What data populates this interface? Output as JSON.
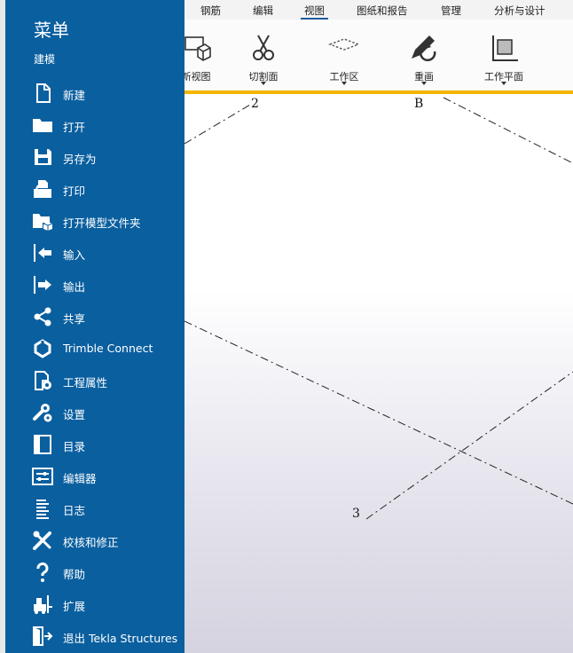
{
  "tabs": [
    {
      "label": "钢筋"
    },
    {
      "label": "编辑"
    },
    {
      "label": "视图"
    },
    {
      "label": "图纸和报告"
    },
    {
      "label": "管理"
    },
    {
      "label": "分析与设计"
    }
  ],
  "ribbon": {
    "items": [
      {
        "label": "新视图",
        "icon": "new-view-icon"
      },
      {
        "label": "切割面",
        "icon": "scissors-icon"
      },
      {
        "label": "工作区",
        "icon": "work-area-icon"
      },
      {
        "label": "重画",
        "icon": "redraw-icon"
      },
      {
        "label": "工作平面",
        "icon": "work-plane-icon"
      }
    ]
  },
  "grid_labels": {
    "top_left": "2",
    "top_right": "B",
    "bottom": "3"
  },
  "menu": {
    "title": "菜单",
    "subtitle": "建模",
    "items": [
      {
        "label": "新建",
        "icon": "new-file-icon"
      },
      {
        "label": "打开",
        "icon": "folder-icon"
      },
      {
        "label": "另存为",
        "icon": "save-icon"
      },
      {
        "label": "打印",
        "icon": "print-icon"
      },
      {
        "label": "打开模型文件夹",
        "icon": "model-folder-icon"
      },
      {
        "label": "输入",
        "icon": "import-icon"
      },
      {
        "label": "输出",
        "icon": "export-icon"
      },
      {
        "label": "共享",
        "icon": "share-icon"
      },
      {
        "label": "Trimble Connect",
        "icon": "trimble-connect-icon"
      },
      {
        "label": "工程属性",
        "icon": "project-properties-icon"
      },
      {
        "label": "设置",
        "icon": "settings-icon"
      },
      {
        "label": "目录",
        "icon": "catalog-icon"
      },
      {
        "label": "编辑器",
        "icon": "editor-icon"
      },
      {
        "label": "日志",
        "icon": "log-icon"
      },
      {
        "label": "校核和修正",
        "icon": "check-fix-icon"
      },
      {
        "label": "帮助",
        "icon": "help-icon"
      },
      {
        "label": "扩展",
        "icon": "extensions-icon"
      },
      {
        "label": "退出 Tekla Structures",
        "icon": "exit-icon"
      }
    ]
  },
  "colors": {
    "menu_bg": "#0a5f9f",
    "ribbon_accent": "#f4b400",
    "tab_underline": "#1f5aa0"
  }
}
